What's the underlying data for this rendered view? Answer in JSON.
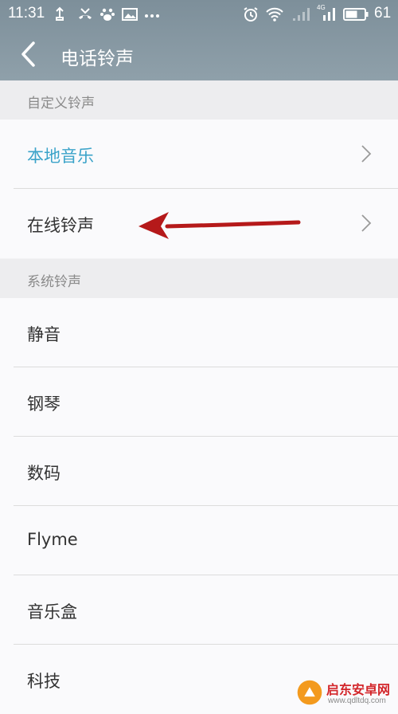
{
  "status": {
    "time": "11:31",
    "battery": "61",
    "network": "4G"
  },
  "header": {
    "title": "电话铃声"
  },
  "sections": [
    {
      "header": "自定义铃声",
      "items": [
        {
          "label": "本地音乐",
          "accent": true,
          "chevron": true
        },
        {
          "label": "在线铃声",
          "accent": false,
          "chevron": true
        }
      ]
    },
    {
      "header": "系统铃声",
      "items": [
        {
          "label": "静音"
        },
        {
          "label": "钢琴"
        },
        {
          "label": "数码"
        },
        {
          "label": "Flyme"
        },
        {
          "label": "音乐盒"
        },
        {
          "label": "科技"
        }
      ]
    }
  ],
  "watermark": {
    "name": "启东安卓网",
    "url": "www.qdltdq.com"
  },
  "colors": {
    "accent": "#3aa3c9",
    "arrow": "#b5191a"
  }
}
